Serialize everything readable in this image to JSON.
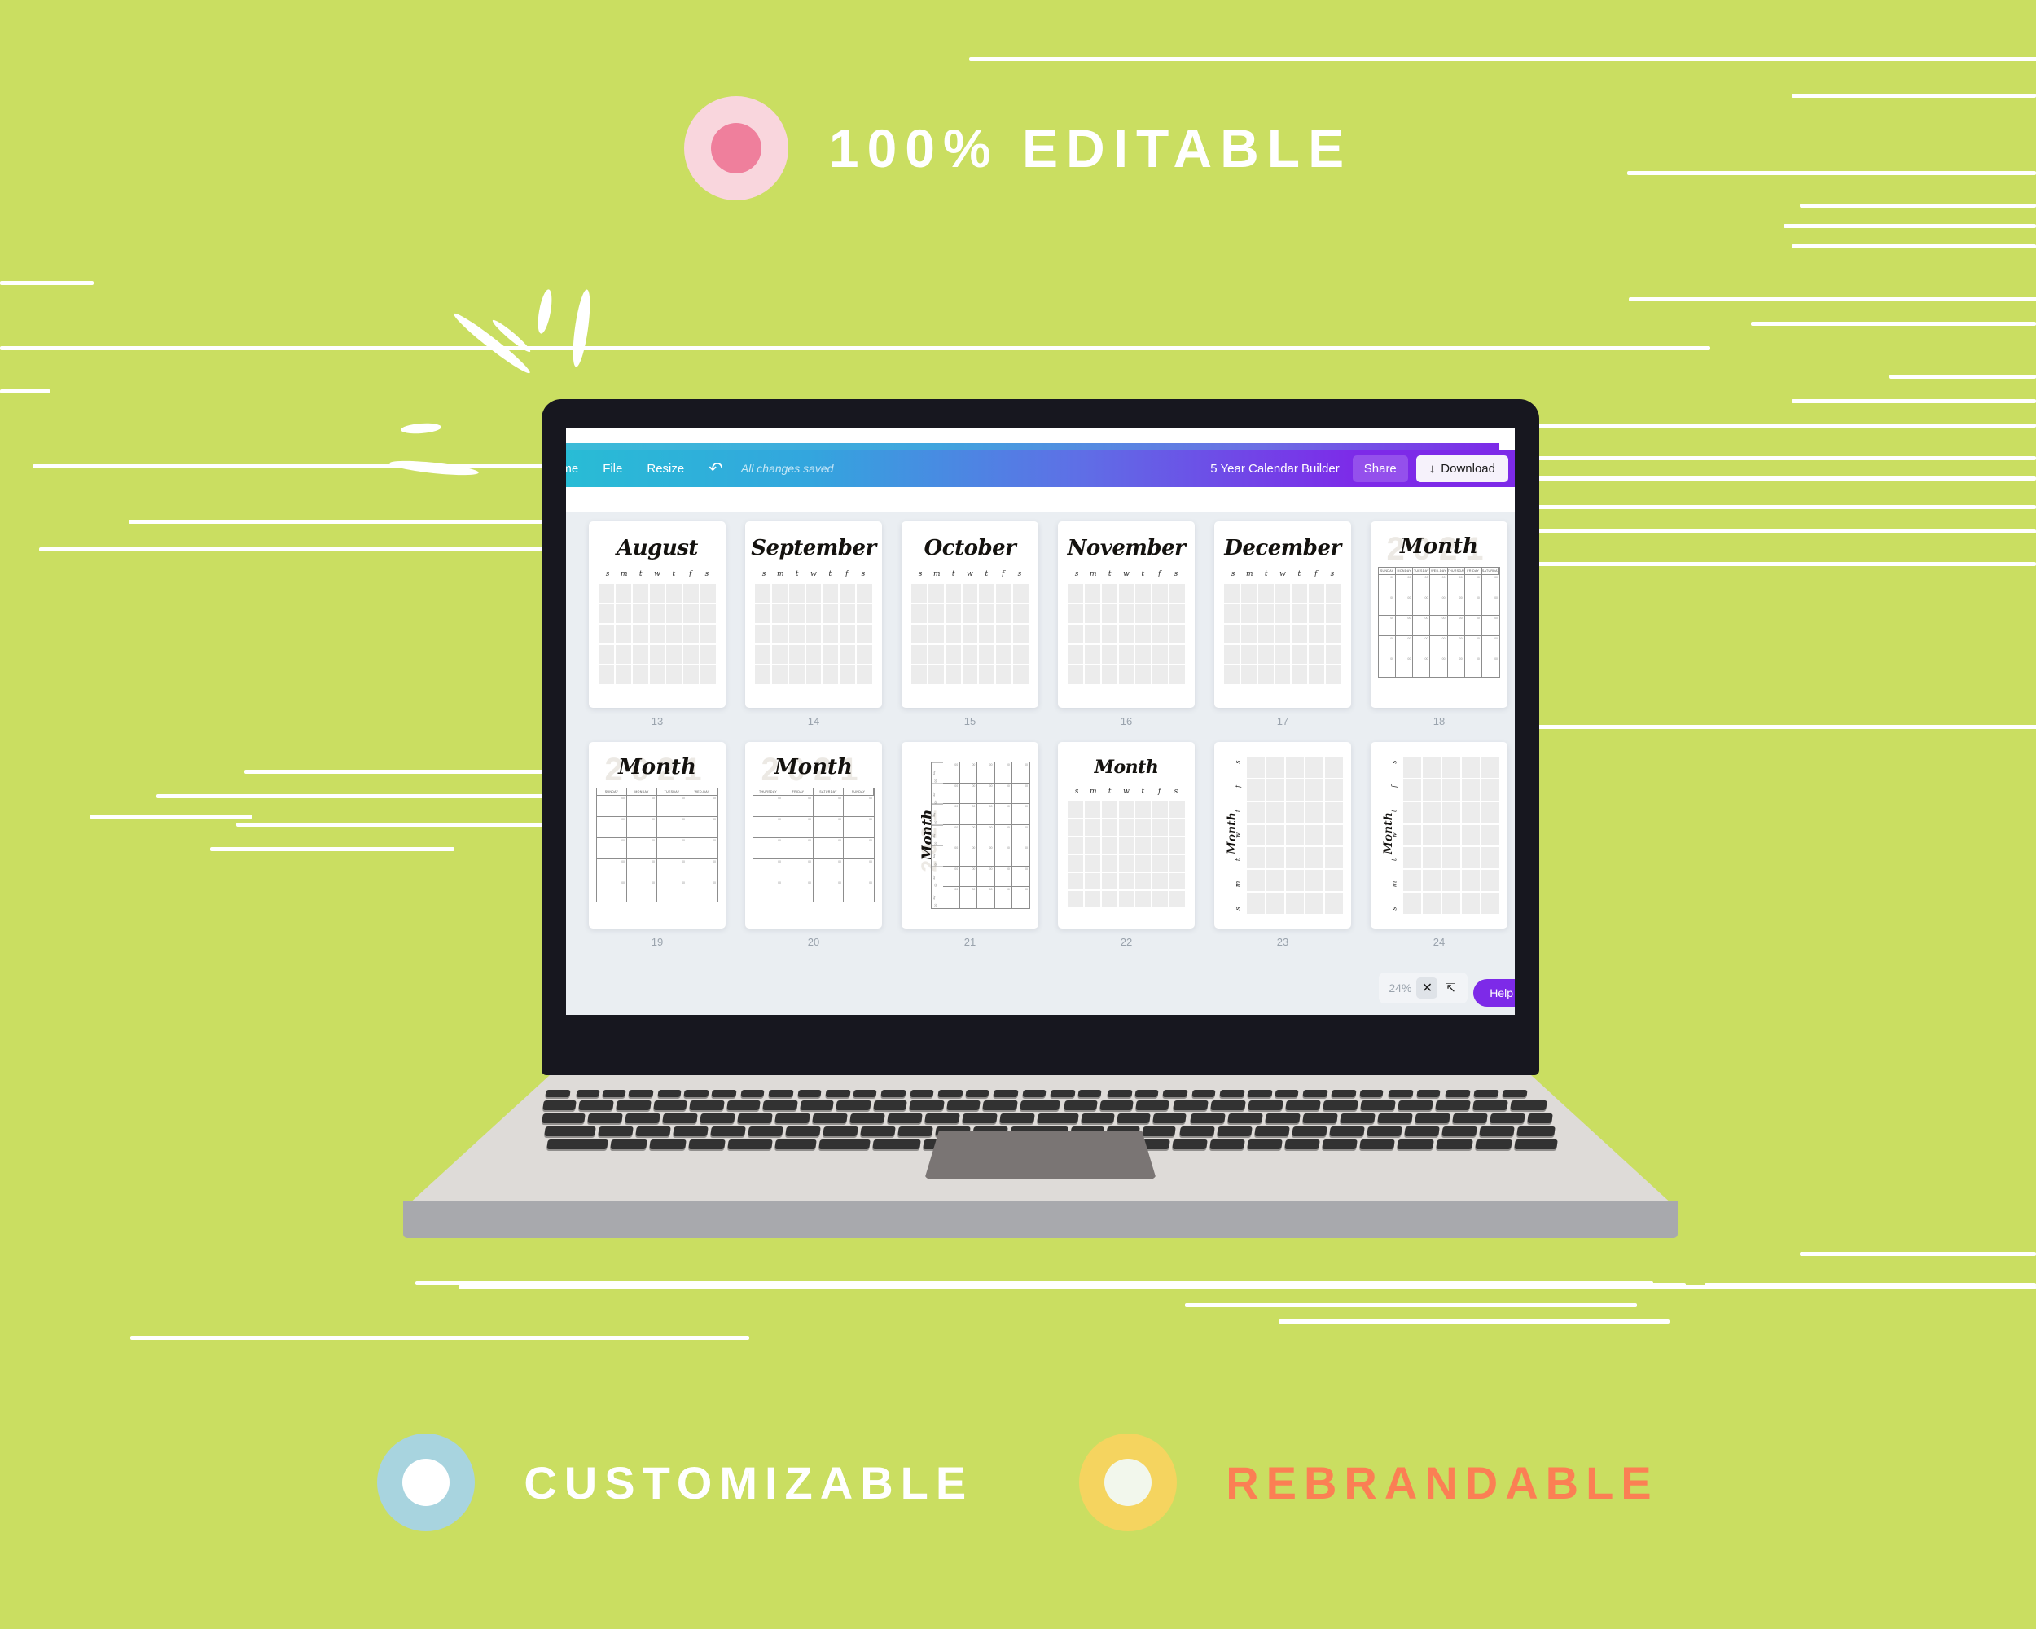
{
  "theme": {
    "background": "#cade61",
    "headline_color": "#ffffff",
    "coral": "#fb7f54",
    "purple": "#7d2ae8"
  },
  "promo": {
    "top": {
      "badge": "pink-dot-badge",
      "text": "100% EDITABLE"
    },
    "bottom": [
      {
        "badge": "blue-dot-badge",
        "text": "CUSTOMIZABLE",
        "color": "#ffffff"
      },
      {
        "badge": "yellow-dot-badge",
        "text": "REBRANDABLE",
        "color": "#fb7f54"
      }
    ]
  },
  "editor": {
    "toolbar": {
      "home": "ome",
      "file": "File",
      "resize": "Resize",
      "undo_icon": "undo-icon",
      "status": "All changes saved",
      "doc_title": "5 Year Calendar Builder",
      "share": "Share",
      "download": "Download",
      "download_icon": "download-arrow-icon"
    },
    "footer": {
      "zoom": "24%",
      "close_icon": "close-icon",
      "expand_icon": "expand-icon",
      "help": "Help"
    },
    "pages": [
      {
        "num": "13",
        "style": "letters",
        "title": "August",
        "days": [
          "s",
          "m",
          "t",
          "w",
          "t",
          "f",
          "s"
        ],
        "rows": 5
      },
      {
        "num": "14",
        "style": "letters",
        "title": "September",
        "days": [
          "s",
          "m",
          "t",
          "w",
          "t",
          "f",
          "s"
        ],
        "rows": 5
      },
      {
        "num": "15",
        "style": "letters",
        "title": "October",
        "days": [
          "s",
          "m",
          "t",
          "w",
          "t",
          "f",
          "s"
        ],
        "rows": 5
      },
      {
        "num": "16",
        "style": "letters",
        "title": "November",
        "days": [
          "s",
          "m",
          "t",
          "w",
          "t",
          "f",
          "s"
        ],
        "rows": 5
      },
      {
        "num": "17",
        "style": "letters",
        "title": "December",
        "days": [
          "s",
          "m",
          "t",
          "w",
          "t",
          "f",
          "s"
        ],
        "rows": 5
      },
      {
        "num": "18",
        "style": "table",
        "title": "Month",
        "year": "2021",
        "days": [
          "SUNDAY",
          "MONDAY",
          "TUESDAY",
          "WED-DAY",
          "THURSDAY",
          "FRIDAY",
          "SATURDAY"
        ],
        "rows": 5
      },
      {
        "num": "19",
        "style": "table",
        "title": "Month",
        "year": "2021",
        "days": [
          "SUNDAY",
          "MONDAY",
          "TUESDAY",
          "WED-DAY"
        ],
        "rows": 5
      },
      {
        "num": "20",
        "style": "table",
        "title": "Month",
        "year": "2021",
        "days": [
          "THURSDAY",
          "FRIDAY",
          "SATURDAY",
          "SUNDAY"
        ],
        "rows": 5
      },
      {
        "num": "21",
        "style": "rotated-table",
        "title": "Month",
        "year": "2021",
        "rows": 7,
        "cols": 5
      },
      {
        "num": "22",
        "style": "letters",
        "title": "Month",
        "days": [
          "s",
          "m",
          "t",
          "w",
          "t",
          "f",
          "s"
        ],
        "rows": 6
      },
      {
        "num": "23",
        "style": "rotated-cells",
        "title": "Month",
        "days": [
          "s",
          "f",
          "t",
          "w",
          "t",
          "m",
          "s"
        ],
        "rows": 7,
        "cols": 5
      },
      {
        "num": "24",
        "style": "rotated-cells",
        "title": "Month",
        "days": [
          "s",
          "f",
          "t",
          "w",
          "t",
          "m",
          "s"
        ],
        "rows": 7,
        "cols": 5
      }
    ]
  }
}
